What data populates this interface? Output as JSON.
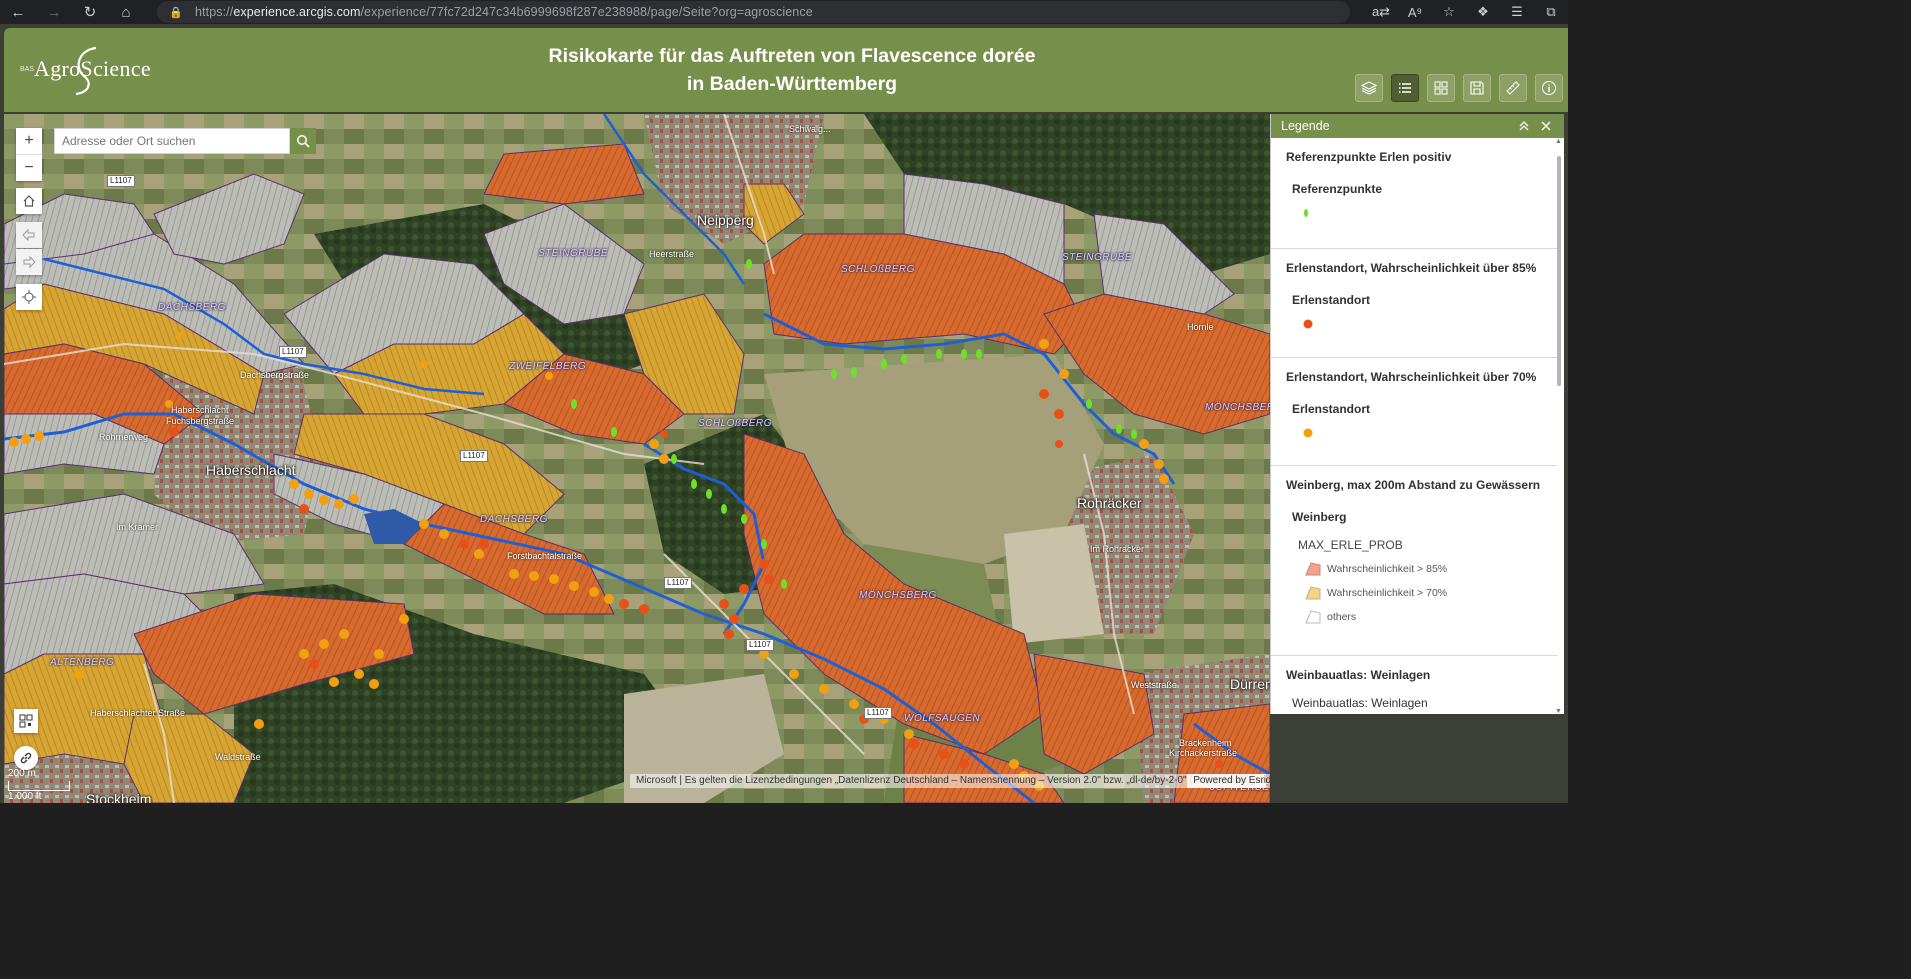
{
  "browser": {
    "url_prefix": "https://",
    "url_host": "experience.arcgis.com",
    "url_path": "/experience/77fc72d247c34b6999698f287e238988/page/Seite?org=agroscience"
  },
  "header": {
    "logo_text": "AgroScience",
    "title_line1": "Risikokarte für das Auftreten von Flavescence dorée",
    "title_line2": "in Baden-Württemberg"
  },
  "toolbar": {
    "buttons": [
      "layers-icon",
      "legend-list-icon",
      "basemap-grid-icon",
      "save-icon",
      "measure-icon",
      "info-icon"
    ]
  },
  "search": {
    "placeholder": "Adresse oder Ort suchen"
  },
  "map": {
    "zoom_in": "+",
    "zoom_out": "−",
    "scale_metric": "200 m",
    "scale_imperial": "1.000 ft",
    "attribution": "Microsoft | Es gelten die Lizenzbedingungen „Datenlizenz Deutschland – Namensnennung – Version 2.0\" bzw. „dl-de/by-2-0\" ( https://www.govdata.de/dl-de/by-2-0 ) mit den dort geforderten ...",
    "powered_by": "Powered by Esri",
    "place_labels": {
      "neipperg": "Neipperg",
      "haberschlacht": "Haberschlacht",
      "rohraecker": "Rohräcker",
      "stockheim": "Stockheim",
      "duerren": "Dürren",
      "brackenheim": "Brackenheim",
      "kirchackerstrasse": "Kirchackerstraße"
    },
    "vineyard_labels": {
      "steingrube_w": "STEINGRUBE",
      "steingrube_e": "STEINGRUBE",
      "schlossberg_n": "SCHLOßBERG",
      "schlossberg_c": "SCHLOßBERG",
      "dachsberg_n": "DACHSBERG",
      "dachsberg_c": "DACHSBERG",
      "zweifelberg": "ZWEIFELBERG",
      "moenchsberg_c": "MÖNCHSBERG",
      "moenchsberg_e": "MÖNCHSBERG",
      "altenberg": "ALTENBERG",
      "wolfsaugen": "WOLFSAUGEN",
      "jupiterberg": "JUPITERBERG"
    },
    "street_labels": {
      "heerstrasse": "Heerstraße",
      "rohrnerweg": "Rohrnerweg",
      "fuchsbergstrasse": "Fuchsbergstraße",
      "haberschlacht_str": "Haberschlacht",
      "im_kraemer": "Im Krämer",
      "forstbachtalstrasse": "Forstbachtalstraße",
      "dachsbergstrasse": "Dachsbergstraße",
      "haberschlachter": "Haberschlachter Straße",
      "waldstrasse": "Waldstraße",
      "im_rohracker": "Im Rohracker",
      "weststrasse": "Weststraße",
      "hornle": "Hörnle",
      "schwaigern": "Schwaig..."
    },
    "road_shields": [
      "L1107",
      "L1107",
      "L1107",
      "L1107",
      "L1107",
      "L1107"
    ]
  },
  "legend": {
    "title": "Legende",
    "sections": [
      {
        "title": "Referenzpunkte Erlen positiv",
        "sub": "Referenzpunkte",
        "symbol_color": "#6ee02a"
      },
      {
        "title": "Erlenstandort, Wahrscheinlichkeit über 85%",
        "sub": "Erlenstandort",
        "symbol_color": "#e8501a"
      },
      {
        "title": "Erlenstandort, Wahrscheinlichkeit über 70%",
        "sub": "Erlenstandort",
        "symbol_color": "#f0a010"
      },
      {
        "title": "Weinberg, max 200m Abstand zu Gewässern",
        "sub": "Weinberg",
        "field": "MAX_ERLE_PROB",
        "classes": [
          {
            "label": "Wahrscheinlichkeit > 85%",
            "color": "#f2a38a"
          },
          {
            "label": "Wahrscheinlichkeit > 70%",
            "color": "#f4d28a"
          },
          {
            "label": "others",
            "color": "#ffffff"
          }
        ]
      },
      {
        "title": "Weinbauatlas: Weinlagen",
        "sub": "Weinbauatlas: Weinlagen"
      }
    ]
  },
  "colors": {
    "header_green": "#76904b",
    "high_risk": "#e06a2a",
    "medium_risk": "#e2a52a",
    "water": "#1f5fd6",
    "reference_point": "#6ee02a"
  }
}
